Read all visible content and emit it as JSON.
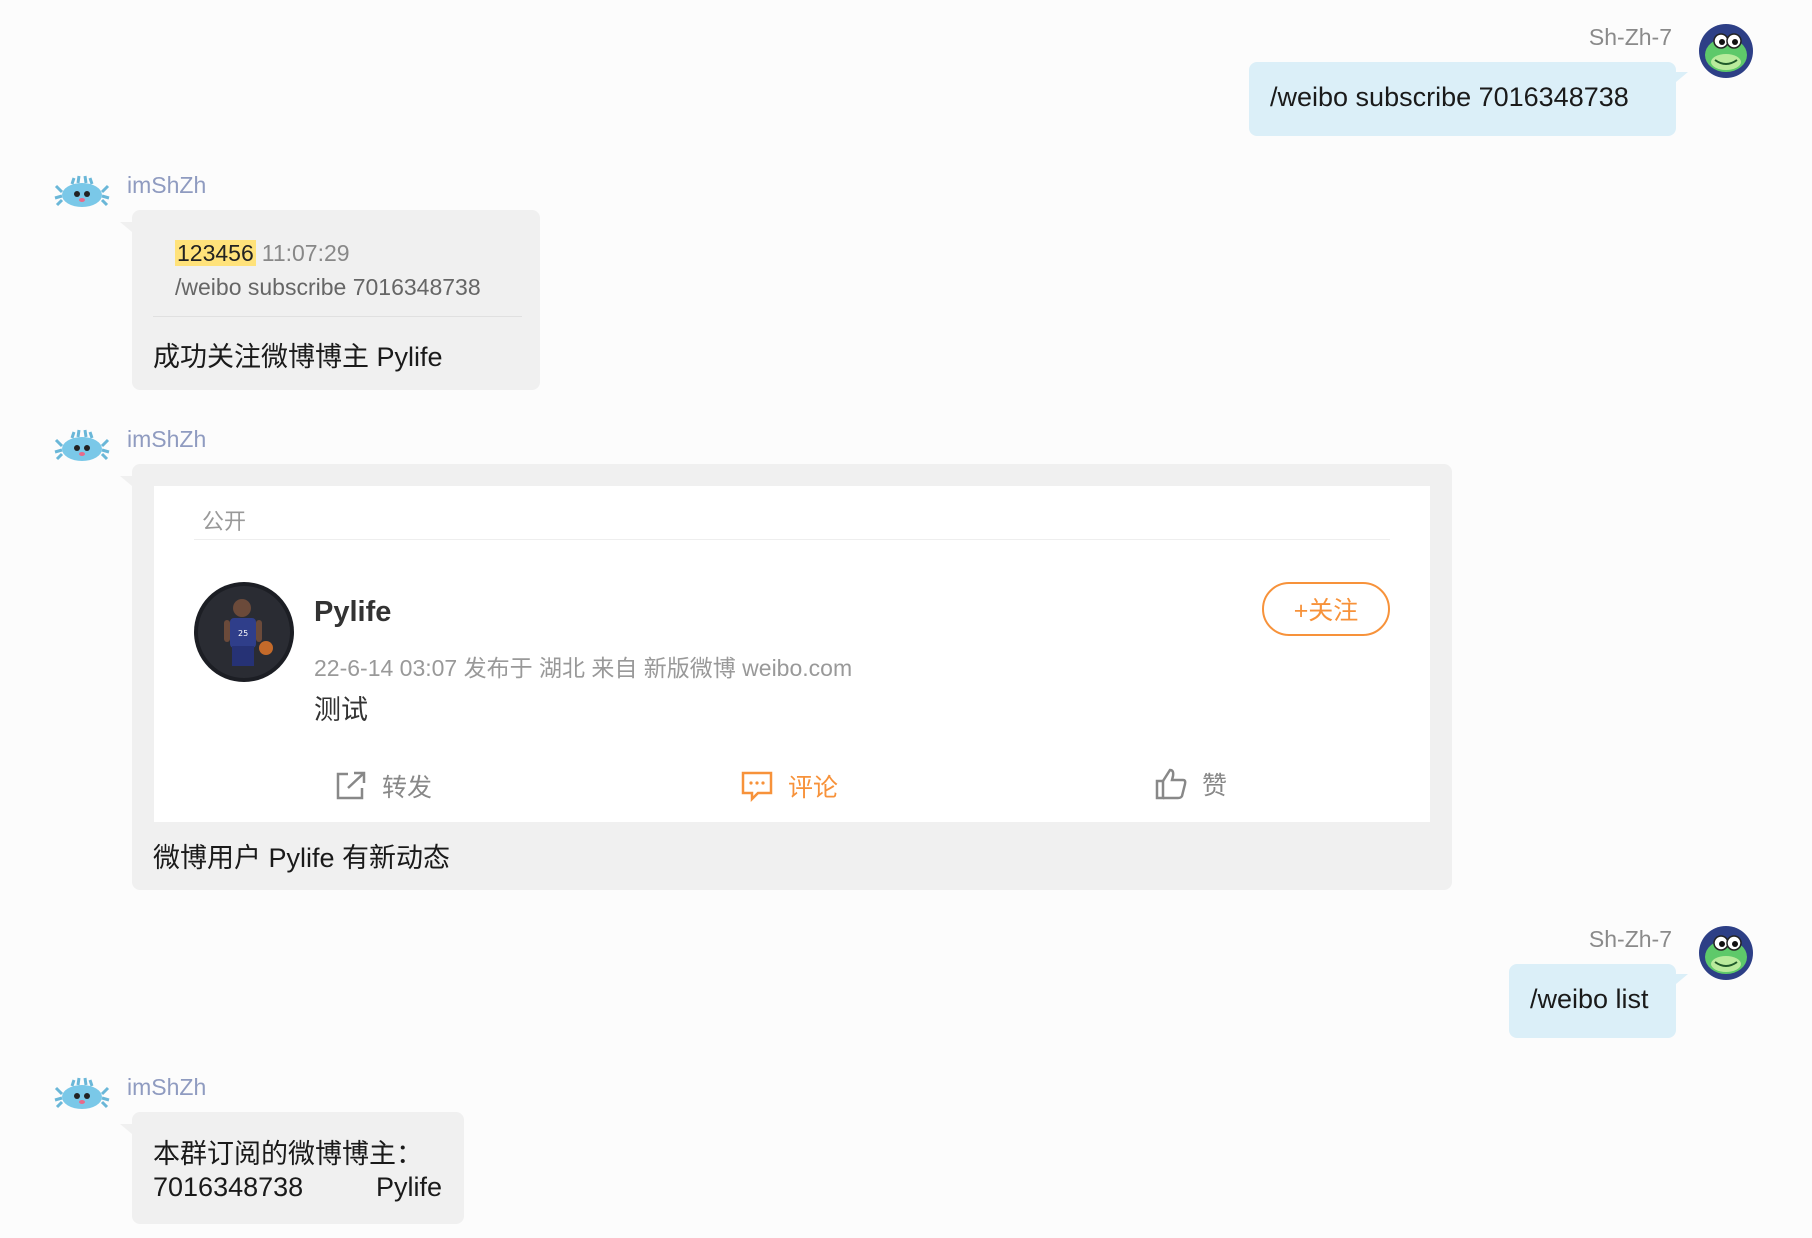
{
  "messages": {
    "m1": {
      "sender": "Sh-Zh-7",
      "text": "/weibo subscribe 7016348738"
    },
    "m2": {
      "sender": "imShZh",
      "quote": {
        "id": "123456",
        "time": "11:07:29",
        "text": "/weibo subscribe 7016348738"
      },
      "text": "成功关注微博博主 Pylife"
    },
    "m3": {
      "sender": "imShZh",
      "card": {
        "visibility": "公开",
        "author": "Pylife",
        "meta": "22-6-14 03:07  发布于 湖北  来自 新版微博 weibo.com",
        "content": "测试",
        "follow_label": "+关注",
        "actions": {
          "repost": "转发",
          "comment": "评论",
          "like": "赞"
        }
      },
      "text": "微博用户 Pylife 有新动态"
    },
    "m4": {
      "sender": "Sh-Zh-7",
      "text": "/weibo list"
    },
    "m5": {
      "sender": "imShZh",
      "line1": "本群订阅的微博博主：",
      "uid": "7016348738",
      "name": "Pylife"
    }
  },
  "colors": {
    "user_bubble": "#dbeff8",
    "bot_bubble": "#f0f0f0",
    "bot_name": "#8f9bc0",
    "user_name": "#8a8a8a",
    "weibo_orange": "#f7923a",
    "quote_highlight": "#ffe27a"
  },
  "icons": {
    "user_avatar": "green-dinosaur-avatar-icon",
    "bot_avatar": "blue-crab-avatar-icon",
    "repost": "share-out-icon",
    "comment": "comment-bubble-icon",
    "like": "thumbs-up-icon"
  }
}
